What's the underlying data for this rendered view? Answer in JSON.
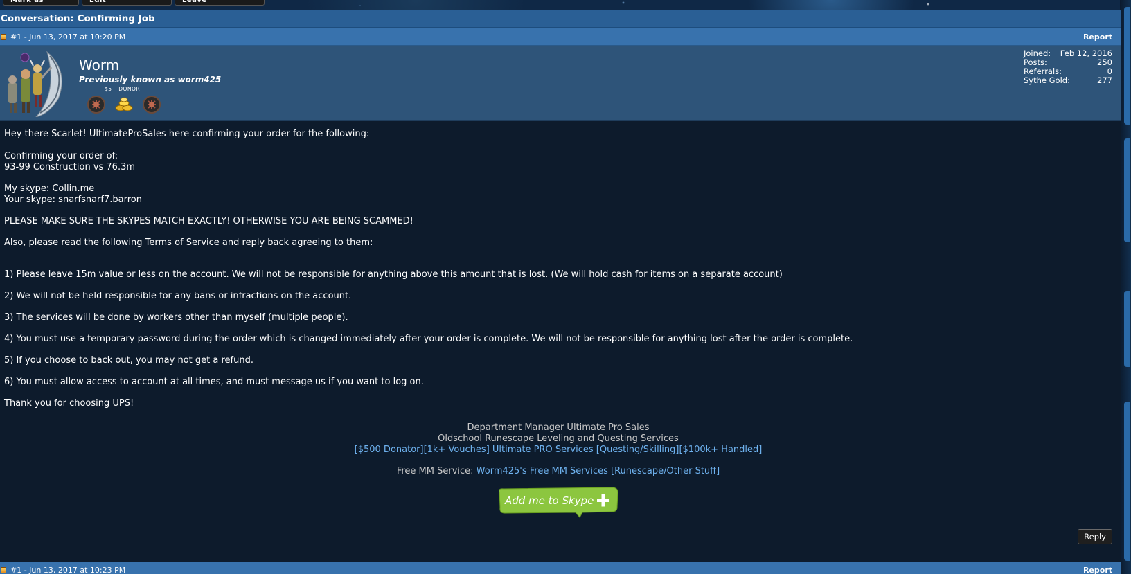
{
  "top_buttons": [
    "Mark as Unread",
    "Edit Conversation",
    "Leave Conversation"
  ],
  "thread": {
    "title": "Conversation: Confirming Job"
  },
  "post1": {
    "meta": "#1 - Jun 13, 2017 at 10:20 PM",
    "report_label": "Report",
    "username": "Worm",
    "usertitle": "Previously known as worm425",
    "donor_tag": "$5+ DONOR",
    "stats": [
      {
        "label": "Joined:",
        "value": "Feb 12, 2016"
      },
      {
        "label": "Posts:",
        "value": "250"
      },
      {
        "label": "Referrals:",
        "value": "0"
      },
      {
        "label": "Sythe Gold:",
        "value": "277"
      }
    ],
    "body": {
      "greeting": "Hey there Scarlet! UltimateProSales here confirming your order for the following:",
      "confirm_label": "Confirming your order of:",
      "order": "93-99 Construction vs 76.3m",
      "my_skype": "My skype: Collin.me",
      "your_skype": "Your skype: snarfsnarf7.barron",
      "warning": "PLEASE MAKE SURE THE SKYPES MATCH EXACTLY! OTHERWISE YOU ARE BEING SCAMMED!",
      "tos_intro": "Also, please read the following Terms of Service and reply back agreeing to them:",
      "tos": [
        "1) Please leave 15m value or less on the account. We will not be responsible for anything above this amount that is lost. (We will hold cash for items on a separate account)",
        "2) We will not be held responsible for any bans or infractions on the account.",
        "3) The services will be done by workers other than myself (multiple people).",
        "4) You must use a temporary password during the order which is changed immediately after your order is complete. We will not be responsible for anything lost after the order is complete.",
        "5) If you choose to back out, you may not get a refund.",
        "6) You must allow access to account at all times, and must message us if you want to log on."
      ],
      "thanks": "Thank you for choosing UPS!"
    },
    "signature": {
      "line1": "Department Manager Ultimate Pro Sales",
      "line2": "Oldschool Runescape Leveling and Questing Services",
      "link1": "[$500 Donator][1k+ Vouches] Ultimate PRO Services [Questing/Skilling][$100k+ Handled]",
      "mm_label": "Free MM Service: ",
      "mm_link": "Worm425's Free MM Services [Runescape/Other Stuff]",
      "skype_button": "Add me to Skype"
    },
    "reply_label": "Reply"
  },
  "post2": {
    "meta": "#1 - Jun 13, 2017 at 10:23 PM",
    "report_label": "Report"
  },
  "colors": {
    "title_bar": "#2a5f95",
    "post_header": "#3872ad",
    "user_bar": "#2e5479",
    "body_bg": "#0d1b2c",
    "link": "#6fb3f0",
    "skype_green": "#8cc63f"
  },
  "icons": [
    "post-status-icon",
    "avatar-image",
    "donor-badge-icon",
    "gold-coins-icon",
    "skype-plus-icon"
  ]
}
